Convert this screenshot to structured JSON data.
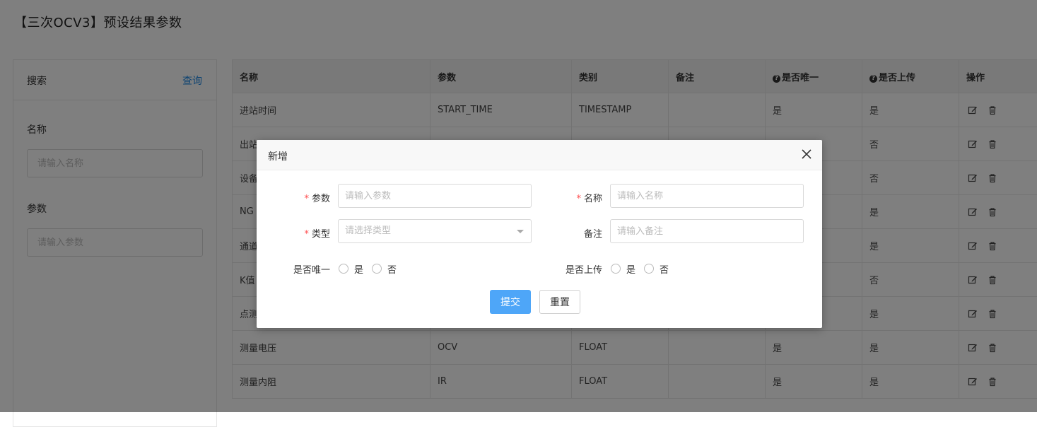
{
  "page": {
    "title": "【三次OCV3】预设结果参数"
  },
  "search": {
    "title": "搜索",
    "query_label": "查询",
    "name_label": "名称",
    "name_placeholder": "请输入名称",
    "param_label": "参数",
    "param_placeholder": "请输入参数"
  },
  "table": {
    "headers": [
      "名称",
      "参数",
      "类别",
      "备注",
      "是否唯一",
      "是否上传",
      "操作"
    ],
    "rows": [
      {
        "name": "进站时间",
        "param": "START_TIME",
        "category": "TIMESTAMP",
        "remark": "",
        "unique": "是",
        "upload": "是"
      },
      {
        "name": "出站",
        "param": "",
        "category": "",
        "remark": "",
        "unique": "",
        "upload": "否"
      },
      {
        "name": "设备",
        "param": "",
        "category": "",
        "remark": "",
        "unique": "",
        "upload": "否"
      },
      {
        "name": "NG",
        "param": "",
        "category": "",
        "remark": "",
        "unique": "",
        "upload": "是"
      },
      {
        "name": "通道",
        "param": "",
        "category": "",
        "remark": "",
        "unique": "",
        "upload": "是"
      },
      {
        "name": "K值",
        "param": "",
        "category": "",
        "remark": "",
        "unique": "",
        "upload": "否"
      },
      {
        "name": "点测",
        "param": "",
        "category": "",
        "remark": "",
        "unique": "",
        "upload": "是"
      },
      {
        "name": "测量电压",
        "param": "OCV",
        "category": "FLOAT",
        "remark": "",
        "unique": "是",
        "upload": "是"
      },
      {
        "name": "测量内阻",
        "param": "IR",
        "category": "FLOAT",
        "remark": "",
        "unique": "是",
        "upload": "是"
      }
    ]
  },
  "modal": {
    "title": "新增",
    "param_label": "参数",
    "param_placeholder": "请输入参数",
    "name_label": "名称",
    "name_placeholder": "请输入名称",
    "type_label": "类型",
    "type_placeholder": "请选择类型",
    "remark_label": "备注",
    "remark_placeholder": "请输入备注",
    "unique_label": "是否唯一",
    "upload_label": "是否上传",
    "yes": "是",
    "no": "否",
    "submit": "提交",
    "reset": "重置"
  },
  "colors": {
    "accent": "#4ea6f8",
    "link": "#1e88e5",
    "required": "#ff4d4f"
  }
}
